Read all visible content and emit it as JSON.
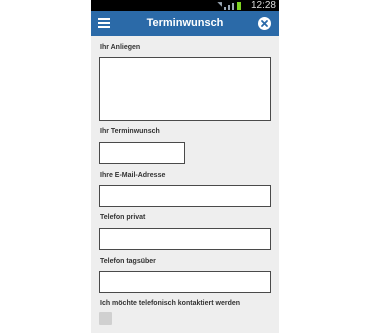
{
  "status_bar": {
    "time": "12:28"
  },
  "app_bar": {
    "title": "Terminwunsch",
    "menu_icon": "hamburger-menu-icon",
    "close_icon": "close-circle-icon",
    "color": "#2b6aa8"
  },
  "form": {
    "anliegen": {
      "label": "Ihr Anliegen",
      "value": ""
    },
    "terminwunsch": {
      "label": "Ihr Terminwunsch",
      "value": ""
    },
    "email": {
      "label": "Ihre E-Mail-Adresse",
      "value": ""
    },
    "telefon_privat": {
      "label": "Telefon privat",
      "value": ""
    },
    "telefon_tagsueber": {
      "label": "Telefon tagsüber",
      "value": ""
    },
    "telefon_kontakt": {
      "label": "Ich möchte telefonisch kontaktiert werden",
      "checked": false
    }
  }
}
